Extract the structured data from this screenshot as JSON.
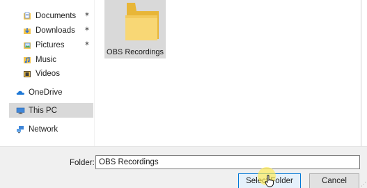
{
  "navigation": {
    "items": [
      {
        "label": "Documents",
        "icon": "documents-folder-icon",
        "pinned": true
      },
      {
        "label": "Downloads",
        "icon": "downloads-folder-icon",
        "pinned": true
      },
      {
        "label": "Pictures",
        "icon": "pictures-folder-icon",
        "pinned": true
      },
      {
        "label": "Music",
        "icon": "music-folder-icon",
        "pinned": false
      },
      {
        "label": "Videos",
        "icon": "videos-folder-icon",
        "pinned": false
      },
      {
        "label": "OneDrive",
        "icon": "onedrive-cloud-icon",
        "pinned": false
      },
      {
        "label": "This PC",
        "icon": "this-pc-icon",
        "pinned": false,
        "selected": true
      },
      {
        "label": "Network",
        "icon": "network-icon",
        "pinned": false
      }
    ]
  },
  "content": {
    "folders": [
      {
        "label": "OBS Recordings",
        "selected": true
      }
    ]
  },
  "footer": {
    "folder_label": "Folder:",
    "folder_value": "OBS Recordings",
    "select_button": "Select Folder",
    "cancel_button": "Cancel"
  },
  "colors": {
    "selection": "#d9d9d9",
    "folder_yellow": "#f8d775",
    "primary_button_border": "#0078d7",
    "onedrive_blue": "#1e78d6"
  }
}
